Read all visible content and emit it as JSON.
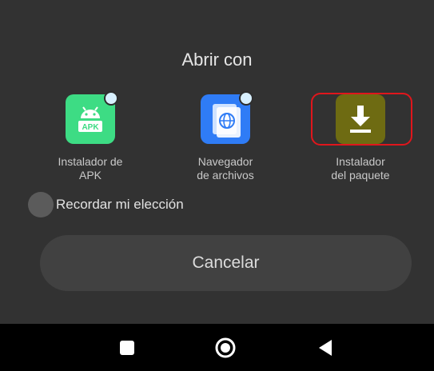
{
  "dialog": {
    "title": "Abrir con",
    "apps": [
      {
        "line1": "Instalador de",
        "line2": "APK",
        "icon": "apk-installer-icon",
        "color": "#3ddc84"
      },
      {
        "line1": "Navegador",
        "line2": "de archivos",
        "icon": "file-browser-icon",
        "color": "#2f7cf6"
      },
      {
        "line1": "Instalador",
        "line2": "del paquete",
        "icon": "package-installer-icon",
        "color": "#6e6b12"
      }
    ],
    "remember_label": "Recordar mi elección",
    "cancel_label": "Cancelar"
  },
  "apk_badge_text": "APK",
  "colors": {
    "sheet_bg": "#323232",
    "highlight": "#e0161c",
    "navbar_bg": "#000000"
  },
  "navbar": {
    "buttons": [
      "recents-square-icon",
      "home-circle-icon",
      "back-triangle-icon"
    ]
  }
}
